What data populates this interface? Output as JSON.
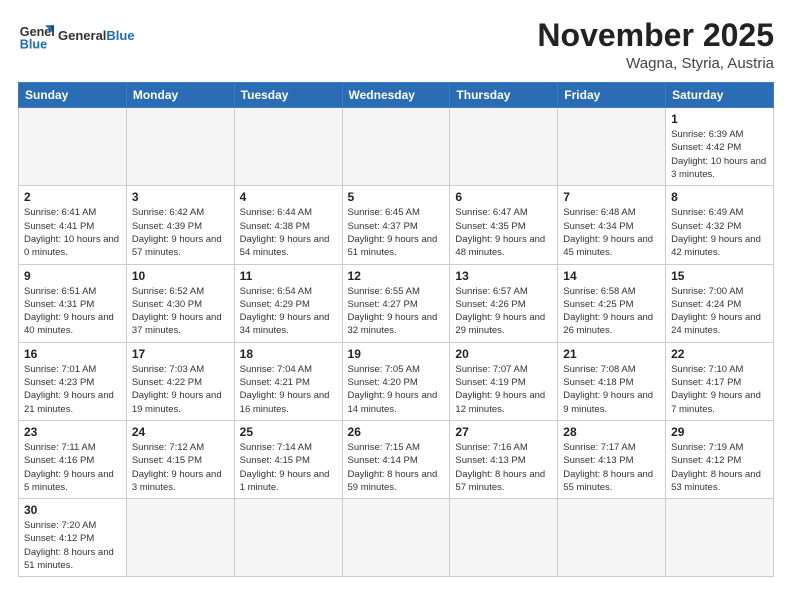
{
  "header": {
    "logo_general": "General",
    "logo_blue": "Blue",
    "month_title": "November 2025",
    "location": "Wagna, Styria, Austria"
  },
  "weekdays": [
    "Sunday",
    "Monday",
    "Tuesday",
    "Wednesday",
    "Thursday",
    "Friday",
    "Saturday"
  ],
  "weeks": [
    [
      {
        "day": "",
        "info": ""
      },
      {
        "day": "",
        "info": ""
      },
      {
        "day": "",
        "info": ""
      },
      {
        "day": "",
        "info": ""
      },
      {
        "day": "",
        "info": ""
      },
      {
        "day": "",
        "info": ""
      },
      {
        "day": "1",
        "info": "Sunrise: 6:39 AM\nSunset: 4:42 PM\nDaylight: 10 hours and 3 minutes."
      }
    ],
    [
      {
        "day": "2",
        "info": "Sunrise: 6:41 AM\nSunset: 4:41 PM\nDaylight: 10 hours and 0 minutes."
      },
      {
        "day": "3",
        "info": "Sunrise: 6:42 AM\nSunset: 4:39 PM\nDaylight: 9 hours and 57 minutes."
      },
      {
        "day": "4",
        "info": "Sunrise: 6:44 AM\nSunset: 4:38 PM\nDaylight: 9 hours and 54 minutes."
      },
      {
        "day": "5",
        "info": "Sunrise: 6:45 AM\nSunset: 4:37 PM\nDaylight: 9 hours and 51 minutes."
      },
      {
        "day": "6",
        "info": "Sunrise: 6:47 AM\nSunset: 4:35 PM\nDaylight: 9 hours and 48 minutes."
      },
      {
        "day": "7",
        "info": "Sunrise: 6:48 AM\nSunset: 4:34 PM\nDaylight: 9 hours and 45 minutes."
      },
      {
        "day": "8",
        "info": "Sunrise: 6:49 AM\nSunset: 4:32 PM\nDaylight: 9 hours and 42 minutes."
      }
    ],
    [
      {
        "day": "9",
        "info": "Sunrise: 6:51 AM\nSunset: 4:31 PM\nDaylight: 9 hours and 40 minutes."
      },
      {
        "day": "10",
        "info": "Sunrise: 6:52 AM\nSunset: 4:30 PM\nDaylight: 9 hours and 37 minutes."
      },
      {
        "day": "11",
        "info": "Sunrise: 6:54 AM\nSunset: 4:29 PM\nDaylight: 9 hours and 34 minutes."
      },
      {
        "day": "12",
        "info": "Sunrise: 6:55 AM\nSunset: 4:27 PM\nDaylight: 9 hours and 32 minutes."
      },
      {
        "day": "13",
        "info": "Sunrise: 6:57 AM\nSunset: 4:26 PM\nDaylight: 9 hours and 29 minutes."
      },
      {
        "day": "14",
        "info": "Sunrise: 6:58 AM\nSunset: 4:25 PM\nDaylight: 9 hours and 26 minutes."
      },
      {
        "day": "15",
        "info": "Sunrise: 7:00 AM\nSunset: 4:24 PM\nDaylight: 9 hours and 24 minutes."
      }
    ],
    [
      {
        "day": "16",
        "info": "Sunrise: 7:01 AM\nSunset: 4:23 PM\nDaylight: 9 hours and 21 minutes."
      },
      {
        "day": "17",
        "info": "Sunrise: 7:03 AM\nSunset: 4:22 PM\nDaylight: 9 hours and 19 minutes."
      },
      {
        "day": "18",
        "info": "Sunrise: 7:04 AM\nSunset: 4:21 PM\nDaylight: 9 hours and 16 minutes."
      },
      {
        "day": "19",
        "info": "Sunrise: 7:05 AM\nSunset: 4:20 PM\nDaylight: 9 hours and 14 minutes."
      },
      {
        "day": "20",
        "info": "Sunrise: 7:07 AM\nSunset: 4:19 PM\nDaylight: 9 hours and 12 minutes."
      },
      {
        "day": "21",
        "info": "Sunrise: 7:08 AM\nSunset: 4:18 PM\nDaylight: 9 hours and 9 minutes."
      },
      {
        "day": "22",
        "info": "Sunrise: 7:10 AM\nSunset: 4:17 PM\nDaylight: 9 hours and 7 minutes."
      }
    ],
    [
      {
        "day": "23",
        "info": "Sunrise: 7:11 AM\nSunset: 4:16 PM\nDaylight: 9 hours and 5 minutes."
      },
      {
        "day": "24",
        "info": "Sunrise: 7:12 AM\nSunset: 4:15 PM\nDaylight: 9 hours and 3 minutes."
      },
      {
        "day": "25",
        "info": "Sunrise: 7:14 AM\nSunset: 4:15 PM\nDaylight: 9 hours and 1 minute."
      },
      {
        "day": "26",
        "info": "Sunrise: 7:15 AM\nSunset: 4:14 PM\nDaylight: 8 hours and 59 minutes."
      },
      {
        "day": "27",
        "info": "Sunrise: 7:16 AM\nSunset: 4:13 PM\nDaylight: 8 hours and 57 minutes."
      },
      {
        "day": "28",
        "info": "Sunrise: 7:17 AM\nSunset: 4:13 PM\nDaylight: 8 hours and 55 minutes."
      },
      {
        "day": "29",
        "info": "Sunrise: 7:19 AM\nSunset: 4:12 PM\nDaylight: 8 hours and 53 minutes."
      }
    ],
    [
      {
        "day": "30",
        "info": "Sunrise: 7:20 AM\nSunset: 4:12 PM\nDaylight: 8 hours and 51 minutes."
      },
      {
        "day": "",
        "info": ""
      },
      {
        "day": "",
        "info": ""
      },
      {
        "day": "",
        "info": ""
      },
      {
        "day": "",
        "info": ""
      },
      {
        "day": "",
        "info": ""
      },
      {
        "day": "",
        "info": ""
      }
    ]
  ]
}
